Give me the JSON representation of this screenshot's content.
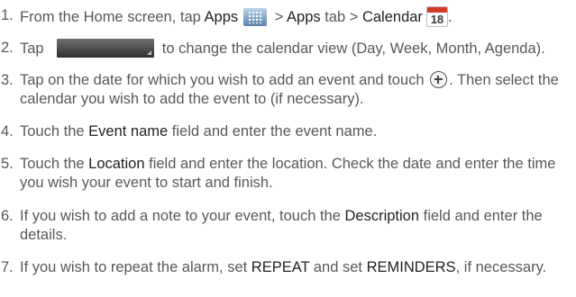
{
  "steps": [
    {
      "num": "1.",
      "t1": "From the Home screen, tap ",
      "k1": "Apps",
      "t2": " > ",
      "k2": "Apps",
      "t3": " tab > ",
      "k3": "Calendar",
      "cal_day": "18",
      "t4": "."
    },
    {
      "num": "2.",
      "t1": "Tap ",
      "t2": " to change the calendar view (Day, Week, Month, Agenda)."
    },
    {
      "num": "3.",
      "t1": "Tap on the date for which you wish to add an event and touch ",
      "t2": ". Then select the calendar you wish to add the event to (if necessary)."
    },
    {
      "num": "4.",
      "t1": "Touch the ",
      "k1": "Event name",
      "t2": " field and enter the event name."
    },
    {
      "num": "5.",
      "t1": "Touch the ",
      "k1": "Location",
      "t2": " field and enter the location. Check the date and enter the time you wish your event to start and finish."
    },
    {
      "num": "6.",
      "t1": "If you wish to add a note to your event, touch the ",
      "k1": "Description",
      "t2": " field and enter the details."
    },
    {
      "num": "7.",
      "t1": "If you wish to repeat the alarm, set ",
      "k1": "REPEAT",
      "t2": " and set ",
      "k2": "REMINDERS",
      "t3": ", if necessary."
    }
  ]
}
